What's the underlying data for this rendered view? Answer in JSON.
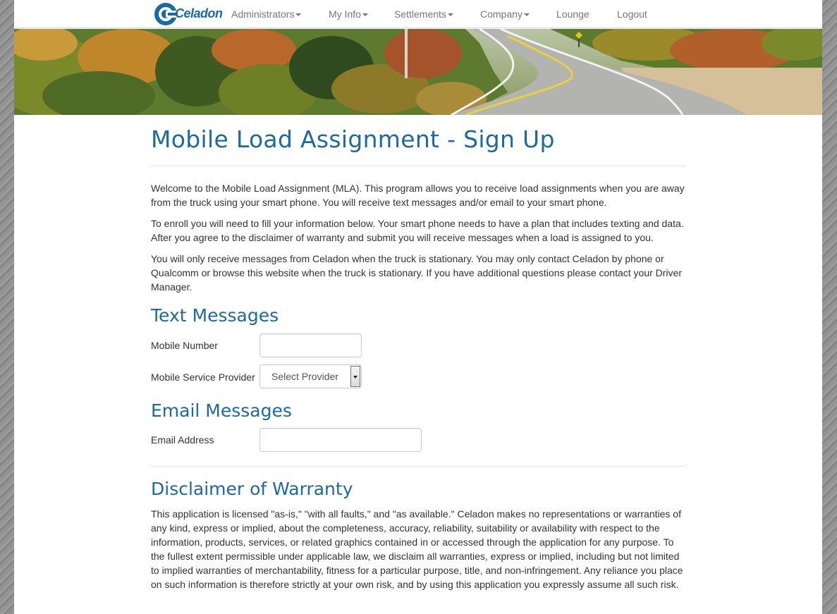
{
  "brand": {
    "name": "Celadon"
  },
  "nav": {
    "administrators": "Administrators",
    "my_info": "My Info",
    "settlements": "Settlements",
    "company": "Company",
    "lounge": "Lounge",
    "logout": "Logout"
  },
  "page": {
    "title": "Mobile Load Assignment - Sign Up",
    "intro": [
      "Welcome to the Mobile Load Assignment (MLA). This program allows you to receive load assignments when you are away from the truck using your smart phone. You will receive text messages and/or email to your smart phone.",
      "To enroll you will need to fill your information below. Your smart phone needs to have a plan that includes texting and data. After you agree to the disclaimer of warranty and submit you will receive messages when a load is assigned to you.",
      "You will only receive messages from Celadon when the truck is stationary. You may only contact Celadon by phone or Qualcomm or browse this website when the truck is stationary. If you have additional questions please contact your Driver Manager."
    ]
  },
  "text_messages": {
    "heading": "Text Messages",
    "mobile_number_label": "Mobile Number",
    "mobile_number_value": "",
    "provider_label": "Mobile Service Provider",
    "provider_selected": "Select Provider"
  },
  "email_messages": {
    "heading": "Email Messages",
    "email_label": "Email Address",
    "email_value": ""
  },
  "disclaimer": {
    "heading": "Disclaimer of Warranty",
    "text": "This application is licensed \"as-is,\" \"with all faults,\" and \"as available.\" Celadon makes no representations or warranties of any kind, express or implied, about the completeness, accuracy, reliability, suitability or availability with respect to the information, products, services, or related graphics contained in or accessed through the application for any purpose. To the fullest extent permissible under applicable law, we disclaim all warranties, express or implied, including but not limited to implied warranties of merchantability, fitness for a particular purpose, title, and non-infringement. Any reliance you place on such information is therefore strictly at your own risk, and by using this application you expressly assume all such risk."
  },
  "colors": {
    "brand_blue": "#1e6a9c",
    "nav_text": "#777777"
  }
}
